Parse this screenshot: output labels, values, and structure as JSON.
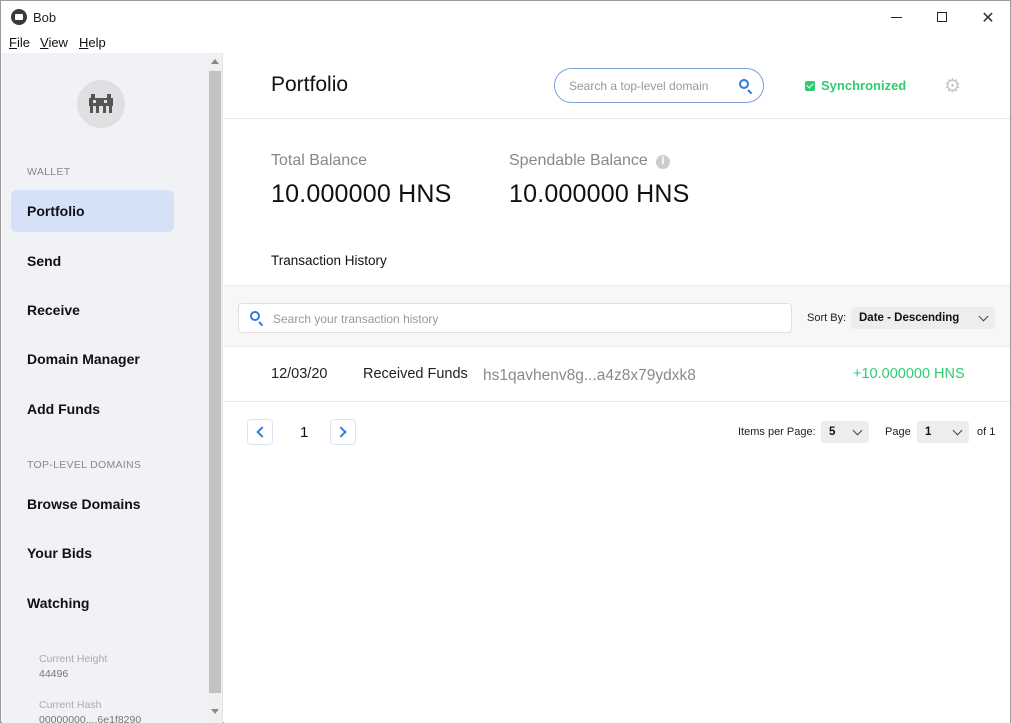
{
  "window": {
    "title": "Bob",
    "controls": {
      "minimize": "minimize-icon",
      "maximize": "maximize-icon",
      "close": "✕"
    }
  },
  "menu": [
    {
      "key": "F",
      "rest": "ile"
    },
    {
      "key": "V",
      "rest": "iew"
    },
    {
      "key": "H",
      "rest": "elp"
    }
  ],
  "sidebar": {
    "wallet_label": "WALLET",
    "wallet_items": [
      "Portfolio",
      "Send",
      "Receive",
      "Domain Manager",
      "Add Funds"
    ],
    "tld_label": "TOP-LEVEL DOMAINS",
    "tld_items": [
      "Browse Domains",
      "Your Bids",
      "Watching"
    ],
    "current_height_label": "Current Height",
    "current_height": "44496",
    "current_hash_label": "Current Hash",
    "current_hash": "00000000....6e1f8290"
  },
  "header": {
    "title": "Portfolio",
    "search_placeholder": "Search a top-level domain",
    "sync_status": "Synchronized"
  },
  "balances": {
    "total_label": "Total Balance",
    "total_value": "10.000000 HNS",
    "spendable_label": "Spendable Balance",
    "spendable_value": "10.000000 HNS"
  },
  "transactions": {
    "heading": "Transaction History",
    "search_placeholder": "Search your transaction history",
    "sort_label": "Sort By:",
    "sort_value": "Date - Descending",
    "rows": [
      {
        "date": "12/03/20",
        "type": "Received Funds",
        "address": "hs1qavhenv8g...a4z8x79ydxk8",
        "amount": "+10.000000 HNS"
      }
    ]
  },
  "pagination": {
    "current_page": "1",
    "items_per_page_label": "Items per Page:",
    "items_per_page": "5",
    "page_label": "Page",
    "page_value": "1",
    "of_label": "of 1"
  },
  "colors": {
    "accent": "#2f7ce0",
    "sync_green": "#2ecc71",
    "active_nav": "#d4e1f6",
    "sidebar_bg": "#f1f2f5"
  }
}
